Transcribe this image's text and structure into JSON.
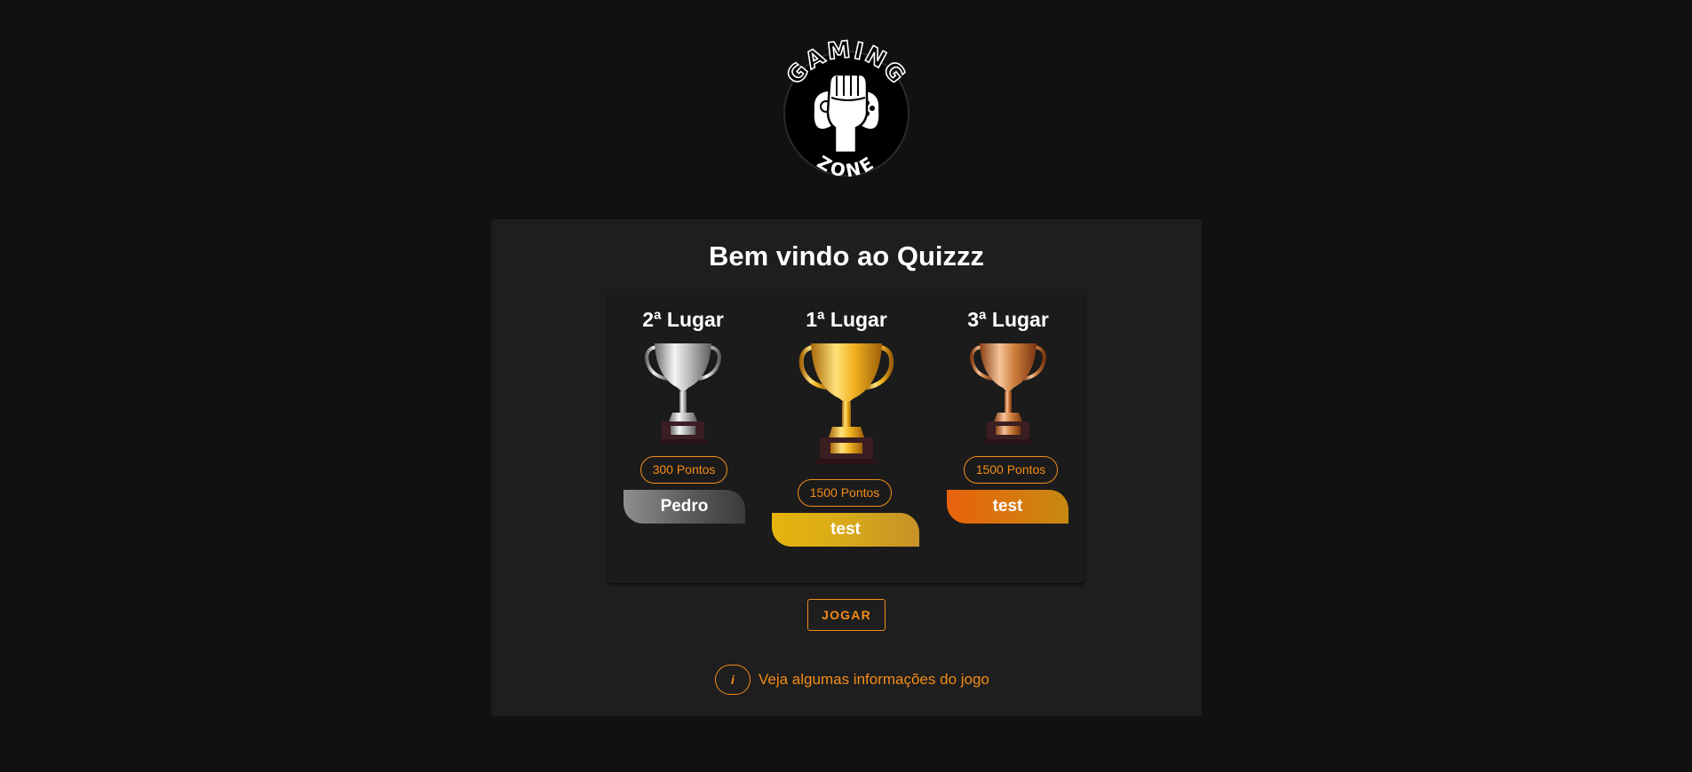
{
  "logo": {
    "top_text": "GAMING",
    "bottom_text": "ZONE"
  },
  "main": {
    "title": "Bem vindo ao Quizzz"
  },
  "podium": {
    "second": {
      "place": "2ª Lugar",
      "points": "300 Pontos",
      "name": "Pedro",
      "trophy": "silver-trophy-icon",
      "color": "#c0c0c0"
    },
    "first": {
      "place": "1ª Lugar",
      "points": "1500 Pontos",
      "name": "test",
      "trophy": "gold-trophy-icon",
      "color": "#e6b40e"
    },
    "third": {
      "place": "3ª Lugar",
      "points": "1500 Pontos",
      "name": "test",
      "trophy": "bronze-trophy-icon",
      "color": "#e8620c"
    }
  },
  "actions": {
    "play_label": "JOGAR",
    "info_icon": "i",
    "info_text": "Veja algumas informações do jogo"
  },
  "colors": {
    "background": "#111111",
    "card": "#1e1e1e",
    "accent": "#f28c18"
  }
}
